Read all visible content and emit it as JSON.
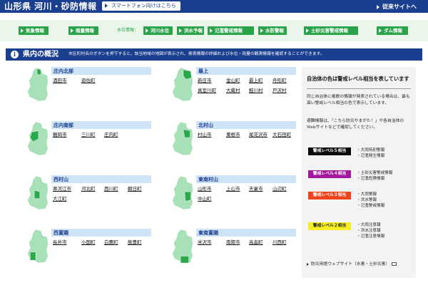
{
  "header": {
    "site_title": "山形県 河川・砂防情報",
    "smartphone_link": "スマートフォン向けはこちら",
    "legacy_link": "従来サイトへ"
  },
  "nav": {
    "water_label": "水位情報：",
    "items": [
      {
        "label": "気象情報"
      },
      {
        "label": "雨量情報"
      },
      {
        "label": "河川水位"
      },
      {
        "label": "洪水予報"
      },
      {
        "label": "氾濫警戒情報"
      },
      {
        "label": "水防警報"
      },
      {
        "label": "土砂災害警戒情報"
      },
      {
        "label": "ダム情報"
      }
    ]
  },
  "section": {
    "title": "県内の概況",
    "description": "市区町村名のボタンを押下すると、該当地域の地図が表示され、発表情報の詳細および水位・雨量の観測情報を確認することができます。"
  },
  "regions": [
    {
      "name": "庄内北部",
      "towns": [
        "酒田市",
        "遊佐町"
      ]
    },
    {
      "name": "最上",
      "towns": [
        "新庄市",
        "金山町",
        "最上町",
        "舟形町",
        "真室川町",
        "大蔵村",
        "鮭川村",
        "戸沢村"
      ]
    },
    {
      "name": "庄内南部",
      "towns": [
        "鶴岡市",
        "三川町",
        "庄内町"
      ]
    },
    {
      "name": "北村山",
      "towns": [
        "村山市",
        "東根市",
        "尾花沢市",
        "大石田町"
      ]
    },
    {
      "name": "西村山",
      "towns": [
        "寒河江市",
        "河北町",
        "西川町",
        "朝日町",
        "大江町"
      ]
    },
    {
      "name": "東南村山",
      "towns": [
        "山形市",
        "上山市",
        "天童市",
        "山辺町",
        "中山町"
      ]
    },
    {
      "name": "西置賜",
      "towns": [
        "長井市",
        "小国町",
        "白鷹町",
        "飯豊町"
      ]
    },
    {
      "name": "東南置賜",
      "towns": [
        "米沢市",
        "南陽市",
        "高畠町",
        "川西町"
      ]
    }
  ],
  "legend": {
    "title": "自治体の色は警戒レベル相当を表しています",
    "desc1": "同じ自治体に複数の情報が発表されている場合は、最も高い警戒レベル相当の色で表示しています。",
    "desc2": "避難情報は、「こちら防災やまがた！」や各自治体のWebサイトなどで確認してください。",
    "levels": [
      {
        "label": "警戒レベル５相当",
        "color": "#0a0a0a",
        "text_color": "#ffffff",
        "items": [
          "・大雨特別警報",
          "・氾濫発生情報"
        ]
      },
      {
        "label": "警戒レベル４相当",
        "color": "#a3189e",
        "text_color": "#ffffff",
        "items": [
          "・土砂災害警戒情報",
          "・氾濫危険情報"
        ]
      },
      {
        "label": "警戒レベル３相当",
        "color": "#f0431c",
        "text_color": "#ffffff",
        "items": [
          "・大雨警報",
          "・洪水警報",
          "・氾濫警戒情報"
        ]
      },
      {
        "label": "警戒レベル２相当",
        "color": "#f4ee22",
        "text_color": "#222222",
        "items": [
          "・大雨注意報",
          "・洪水注意報",
          "・氾濫注意情報"
        ]
      }
    ],
    "glossary_link": "防災用語ウェブサイト（水害・土砂災害）"
  },
  "colors": {
    "header": "#1b3f8f",
    "nav_button": "#2ba34a",
    "nav_band": "#eaf6ea",
    "region_header": "#cfe3f7",
    "map_fill": "#a8e0b8",
    "map_highlight": "#2aa84a"
  }
}
